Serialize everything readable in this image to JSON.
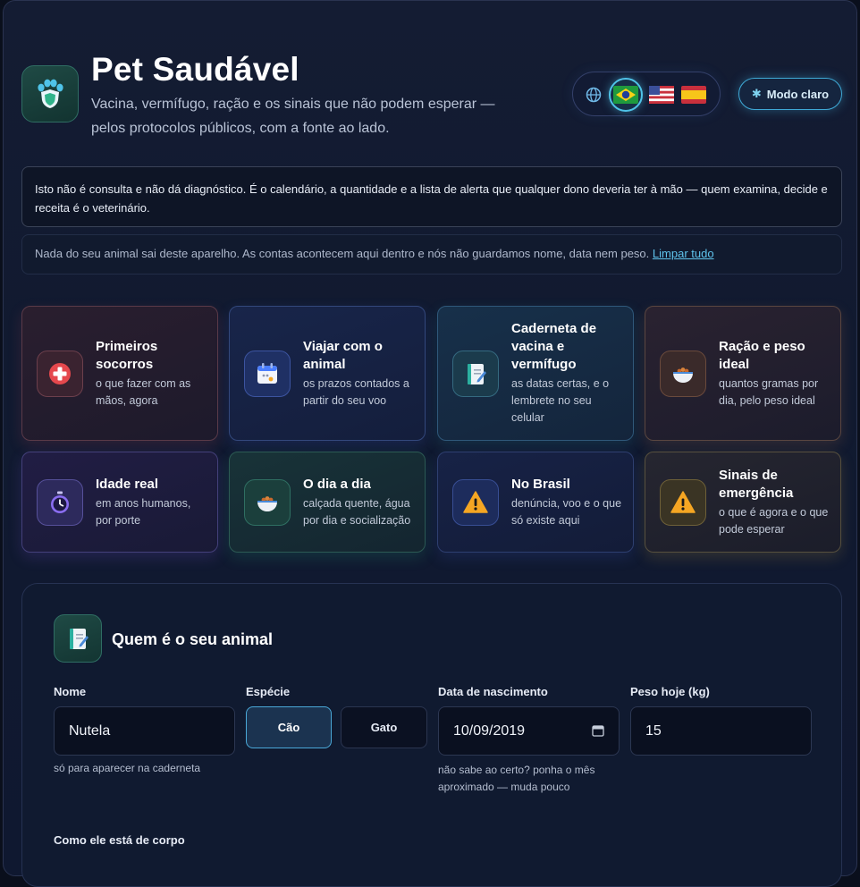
{
  "header": {
    "title": "Pet Saudável",
    "subtitle": "Vacina, vermífugo, ração e os sinais que não podem esperar — pelos protocolos públicos, com a fonte ao lado.",
    "logo_icon": "paw-shield-icon",
    "theme_toggle_label": "Modo claro",
    "theme_icon": "snowflake-icon",
    "languages": [
      {
        "code": "pt-BR",
        "icon": "flag-brazil-icon",
        "active": true
      },
      {
        "code": "en-US",
        "icon": "flag-usa-icon",
        "active": false
      },
      {
        "code": "es-ES",
        "icon": "flag-spain-icon",
        "active": false
      }
    ]
  },
  "disclaimer": "Isto não é consulta e não dá diagnóstico. É o calendário, a quantidade e a lista de alerta que qualquer dono deveria ter à mão — quem examina, decide e receita é o veterinário.",
  "privacy": {
    "text": "Nada do seu animal sai deste aparelho. As contas acontecem aqui dentro e nós não guardamos nome, data nem peso.",
    "clear_link": "Limpar tudo"
  },
  "cards": [
    {
      "title": "Primeiros socorros",
      "desc": "o que fazer com as mãos, agora",
      "icon": "first-aid-icon",
      "accent": "#e5484d"
    },
    {
      "title": "Viajar com o animal",
      "desc": "os prazos contados a partir do seu voo",
      "icon": "calendar-icon",
      "accent": "#4a7dff"
    },
    {
      "title": "Caderneta de vacina e vermífugo",
      "desc": "as datas certas, e o lembrete no seu celular",
      "icon": "notebook-icon",
      "accent": "#2bb0a0"
    },
    {
      "title": "Ração e peso ideal",
      "desc": "quantos gramas por dia, pelo peso ideal",
      "icon": "food-bowl-icon",
      "accent": "#e08a3c"
    },
    {
      "title": "Idade real",
      "desc": "em anos humanos, por porte",
      "icon": "stopwatch-icon",
      "accent": "#8a6df0"
    },
    {
      "title": "O dia a dia",
      "desc": "calçada quente, água por dia e socialização",
      "icon": "food-bowl-icon",
      "accent": "#2fbf8a"
    },
    {
      "title": "No Brasil",
      "desc": "denúncia, voo e o que só existe aqui",
      "icon": "warning-icon",
      "accent": "#f5a623"
    },
    {
      "title": "Sinais de emergência",
      "desc": "o que é agora e o que pode esperar",
      "icon": "warning-icon",
      "accent": "#e0b040"
    }
  ],
  "form": {
    "title": "Quem é o seu animal",
    "icon": "notebook-icon",
    "name_label": "Nome",
    "name_value": "Nutela",
    "name_hint": "só para aparecer na caderneta",
    "species_label": "Espécie",
    "species_options": [
      "Cão",
      "Gato"
    ],
    "species_selected": "Cão",
    "birth_label": "Data de nascimento",
    "birth_value": "10/09/2019",
    "birth_hint": "não sabe ao certo? ponha o mês aproximado — muda pouco",
    "weight_label": "Peso hoje (kg)",
    "weight_value": "15",
    "body_label": "Como ele está de corpo"
  }
}
